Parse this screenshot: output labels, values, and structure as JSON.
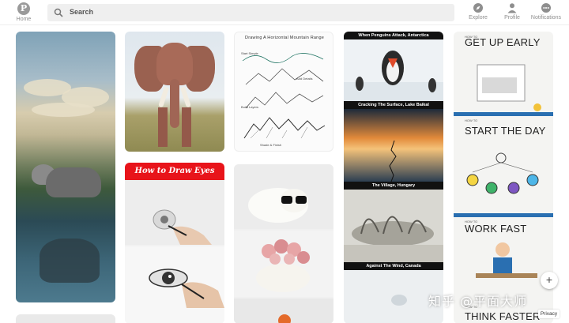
{
  "header": {
    "home_label": "Home",
    "search_placeholder": "Search",
    "explore_label": "Explore",
    "profile_label": "Profile",
    "notifications_label": "Notifications",
    "logo_glyph": "P"
  },
  "pins": {
    "horizon": {
      "title": "Drawing A Horizontal Mountain Range",
      "notes": [
        "Start Simple",
        "Add Details",
        "Build Layers",
        "Shade & Finish"
      ]
    },
    "penguins": {
      "captions": [
        "When Penguins Attack, Antarctica",
        "Cracking The Surface, Lake Baikal",
        "The Village, Hungary",
        "Against The Wind, Canada"
      ]
    },
    "infographic": {
      "headings": [
        "GET UP EARLY",
        "START THE DAY",
        "WORK FAST",
        "THINK FASTER"
      ],
      "how_to": "HOW TO"
    },
    "eyes": {
      "banner": "How to Draw Eyes"
    }
  },
  "overlay": {
    "plus": "+",
    "privacy": "Privacy",
    "watermark": "知乎 @平面大师"
  },
  "colors": {
    "accent_red": "#e8141a",
    "header_bg": "#ffffff",
    "search_bg": "#efefef"
  }
}
